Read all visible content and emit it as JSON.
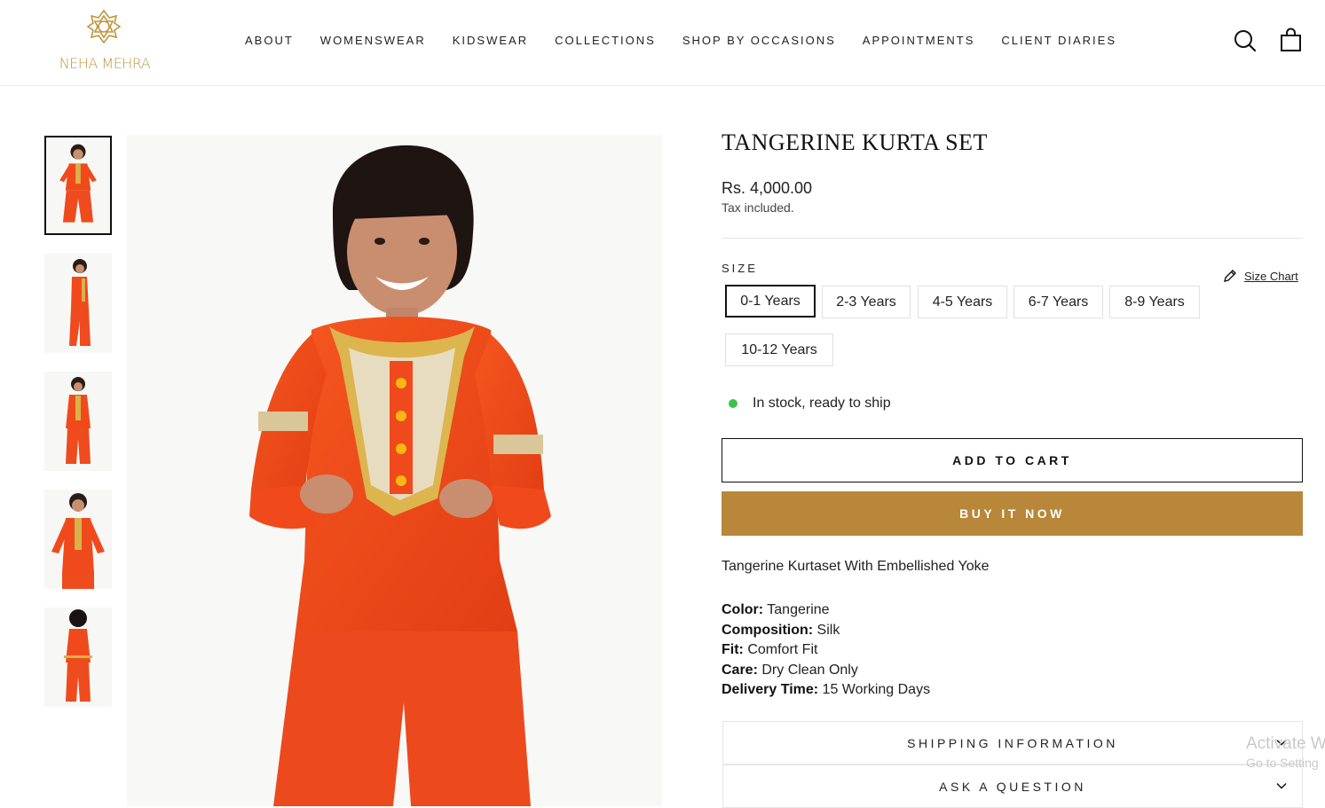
{
  "brand": {
    "name": "NEHA MEHRA"
  },
  "nav": {
    "items": [
      "ABOUT",
      "WOMENSWEAR",
      "KIDSWEAR",
      "COLLECTIONS",
      "SHOP BY OCCASIONS",
      "APPOINTMENTS",
      "CLIENT DIARIES"
    ]
  },
  "header_icons": {
    "search": "search-icon",
    "cart": "bag-icon"
  },
  "colors": {
    "accent": "#b8873a",
    "logo": "#c0953c",
    "stock": "#3ac14a",
    "garment": "#f04a1c"
  },
  "gallery": {
    "thumbnail_count": 5,
    "active_index": 0
  },
  "product": {
    "title": "TANGERINE KURTA SET",
    "price": "Rs. 4,000.00",
    "tax_note": "Tax included.",
    "size_label": "SIZE",
    "size_chart_label": "Size Chart",
    "sizes": [
      "0-1 Years",
      "2-3 Years",
      "4-5 Years",
      "6-7 Years",
      "8-9 Years",
      "10-12 Years"
    ],
    "selected_size": "0-1 Years",
    "stock_text": "In stock, ready to ship",
    "add_to_cart": "ADD TO CART",
    "buy_now": "BUY IT NOW",
    "description": "Tangerine Kurtaset With Embellished Yoke",
    "specs": [
      {
        "label": "Color:",
        "value": "Tangerine"
      },
      {
        "label": "Composition:",
        "value": "Silk"
      },
      {
        "label": "Fit:",
        "value": "Comfort Fit"
      },
      {
        "label": "Care:",
        "value": "Dry Clean Only"
      },
      {
        "label": "Delivery Time:",
        "value": "15 Working Days"
      }
    ]
  },
  "accordions": [
    "SHIPPING INFORMATION",
    "ASK A QUESTION"
  ],
  "watermark": {
    "line1": "Activate W",
    "line2": "Go to Setting"
  }
}
